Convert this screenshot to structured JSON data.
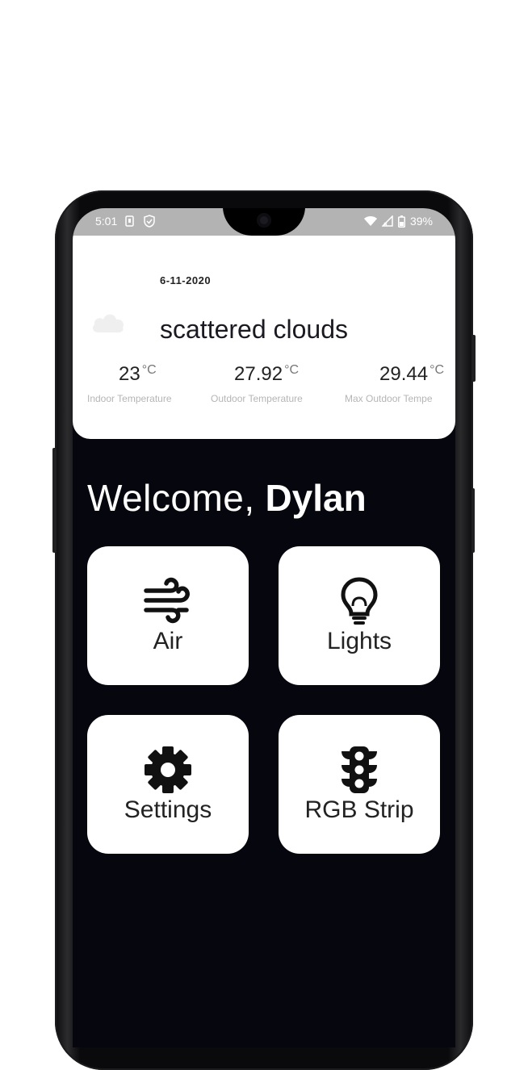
{
  "status_bar": {
    "time": "5:01",
    "battery": "39%",
    "icons": [
      "sim-icon",
      "shield-icon",
      "wifi-icon",
      "signal-icon",
      "battery-icon"
    ]
  },
  "weather": {
    "date": "6-11-2020",
    "condition": "scattered clouds",
    "icon": "cloud-icon",
    "temps": [
      {
        "value": "23",
        "unit": "°C",
        "label": "Indoor Temperature"
      },
      {
        "value": "27.92",
        "unit": "°C",
        "label": "Outdoor Temperature"
      },
      {
        "value": "29.44",
        "unit": "°C",
        "label": "Max Outdoor Tempe"
      }
    ]
  },
  "welcome": {
    "greeting": "Welcome,",
    "name": "Dylan"
  },
  "tiles": [
    {
      "label": "Air",
      "icon": "wind-icon"
    },
    {
      "label": "Lights",
      "icon": "lightbulb-icon"
    },
    {
      "label": "Settings",
      "icon": "gear-icon"
    },
    {
      "label": "RGB Strip",
      "icon": "traffic-light-icon"
    }
  ],
  "colors": {
    "background": "#06060f",
    "card": "#ffffff",
    "text_dark": "#222222",
    "status_bar": "#b3b3b3"
  }
}
